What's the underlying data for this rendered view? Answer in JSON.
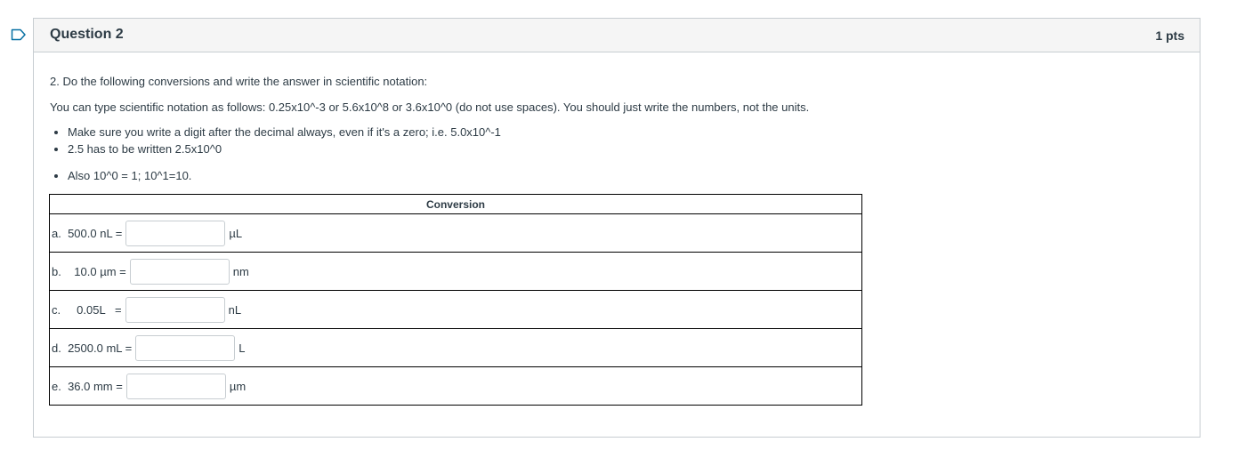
{
  "question": {
    "title": "Question 2",
    "points": "1 pts",
    "prompt": "2. Do the following conversions and write the answer in scientific notation:",
    "instructions": "You can type scientific notation as follows: 0.25x10^-3 or 5.6x10^8 or 3.6x10^0 (do not use spaces). You should just write the numbers, not the units.",
    "bullets_1": [
      "Make sure you write a digit after the decimal always, even if it's a zero; i.e. 5.0x10^-1",
      "2.5 has to be written 2.5x10^0"
    ],
    "bullets_2": [
      "Also 10^0 = 1; 10^1=10."
    ]
  },
  "table": {
    "header": "Conversion",
    "rows": [
      {
        "label": "a.  500.0 nL =",
        "value": "",
        "unit": "µL"
      },
      {
        "label": "b.    10.0 µm =",
        "value": "",
        "unit": "nm"
      },
      {
        "label": "c.     0.05L   =",
        "value": "",
        "unit": "nL"
      },
      {
        "label": "d.  2500.0 mL =",
        "value": "",
        "unit": "L"
      },
      {
        "label": "e.  36.0 mm =",
        "value": "",
        "unit": "µm"
      }
    ]
  },
  "colors": {
    "flag": "#0770a3",
    "border": "#c7cdd1",
    "header_bg": "#f5f5f5",
    "text": "#2d3b45"
  },
  "icons": {
    "flag": "bookmark-flag-icon"
  }
}
